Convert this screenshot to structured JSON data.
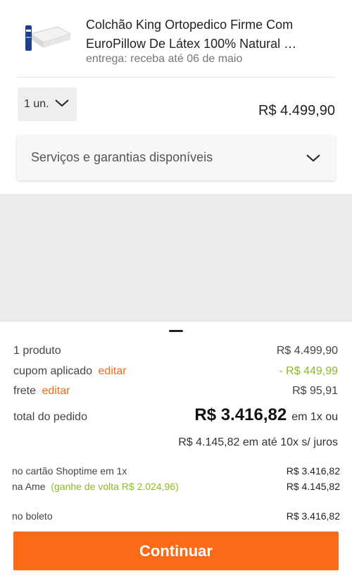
{
  "product": {
    "title": "Colchão King Ortopedico Firme Com EuroPillow De Látex 100% Natural …",
    "delivery": "entrega: receba até 06 de maio",
    "image_icon": "mattress-image",
    "quantity": "1 un.",
    "price": "R$ 4.499,90"
  },
  "services": {
    "label": "Serviços e garantias disponíveis"
  },
  "summary": {
    "products_label": "1 produto",
    "products_value": "R$ 4.499,90",
    "coupon_label": "cupom aplicado",
    "coupon_edit": "editar",
    "coupon_value": "- R$ 449,99",
    "shipping_label": "frete",
    "shipping_edit": "editar",
    "shipping_value": "R$ 95,91",
    "total_label": "total do pedido",
    "total_value": "R$ 3.416,82",
    "total_suffix": "em 1x ou",
    "installment": "R$ 4.145,82 em até 10x s/ juros"
  },
  "payment": {
    "card_label": "no cartão Shoptime em 1x",
    "card_value": "R$ 3.416,82",
    "ame_label": "na Ame",
    "ame_cashback": "(ganhe de volta R$ 2.024,96)",
    "ame_value": "R$ 4.145,82",
    "boleto_label": "no boleto",
    "boleto_value": "R$ 3.416,82"
  },
  "cta": {
    "label": "Continuar"
  },
  "colors": {
    "accent": "#fb6a16",
    "link": "#ec6d1b",
    "discount": "#8bbc1f"
  }
}
